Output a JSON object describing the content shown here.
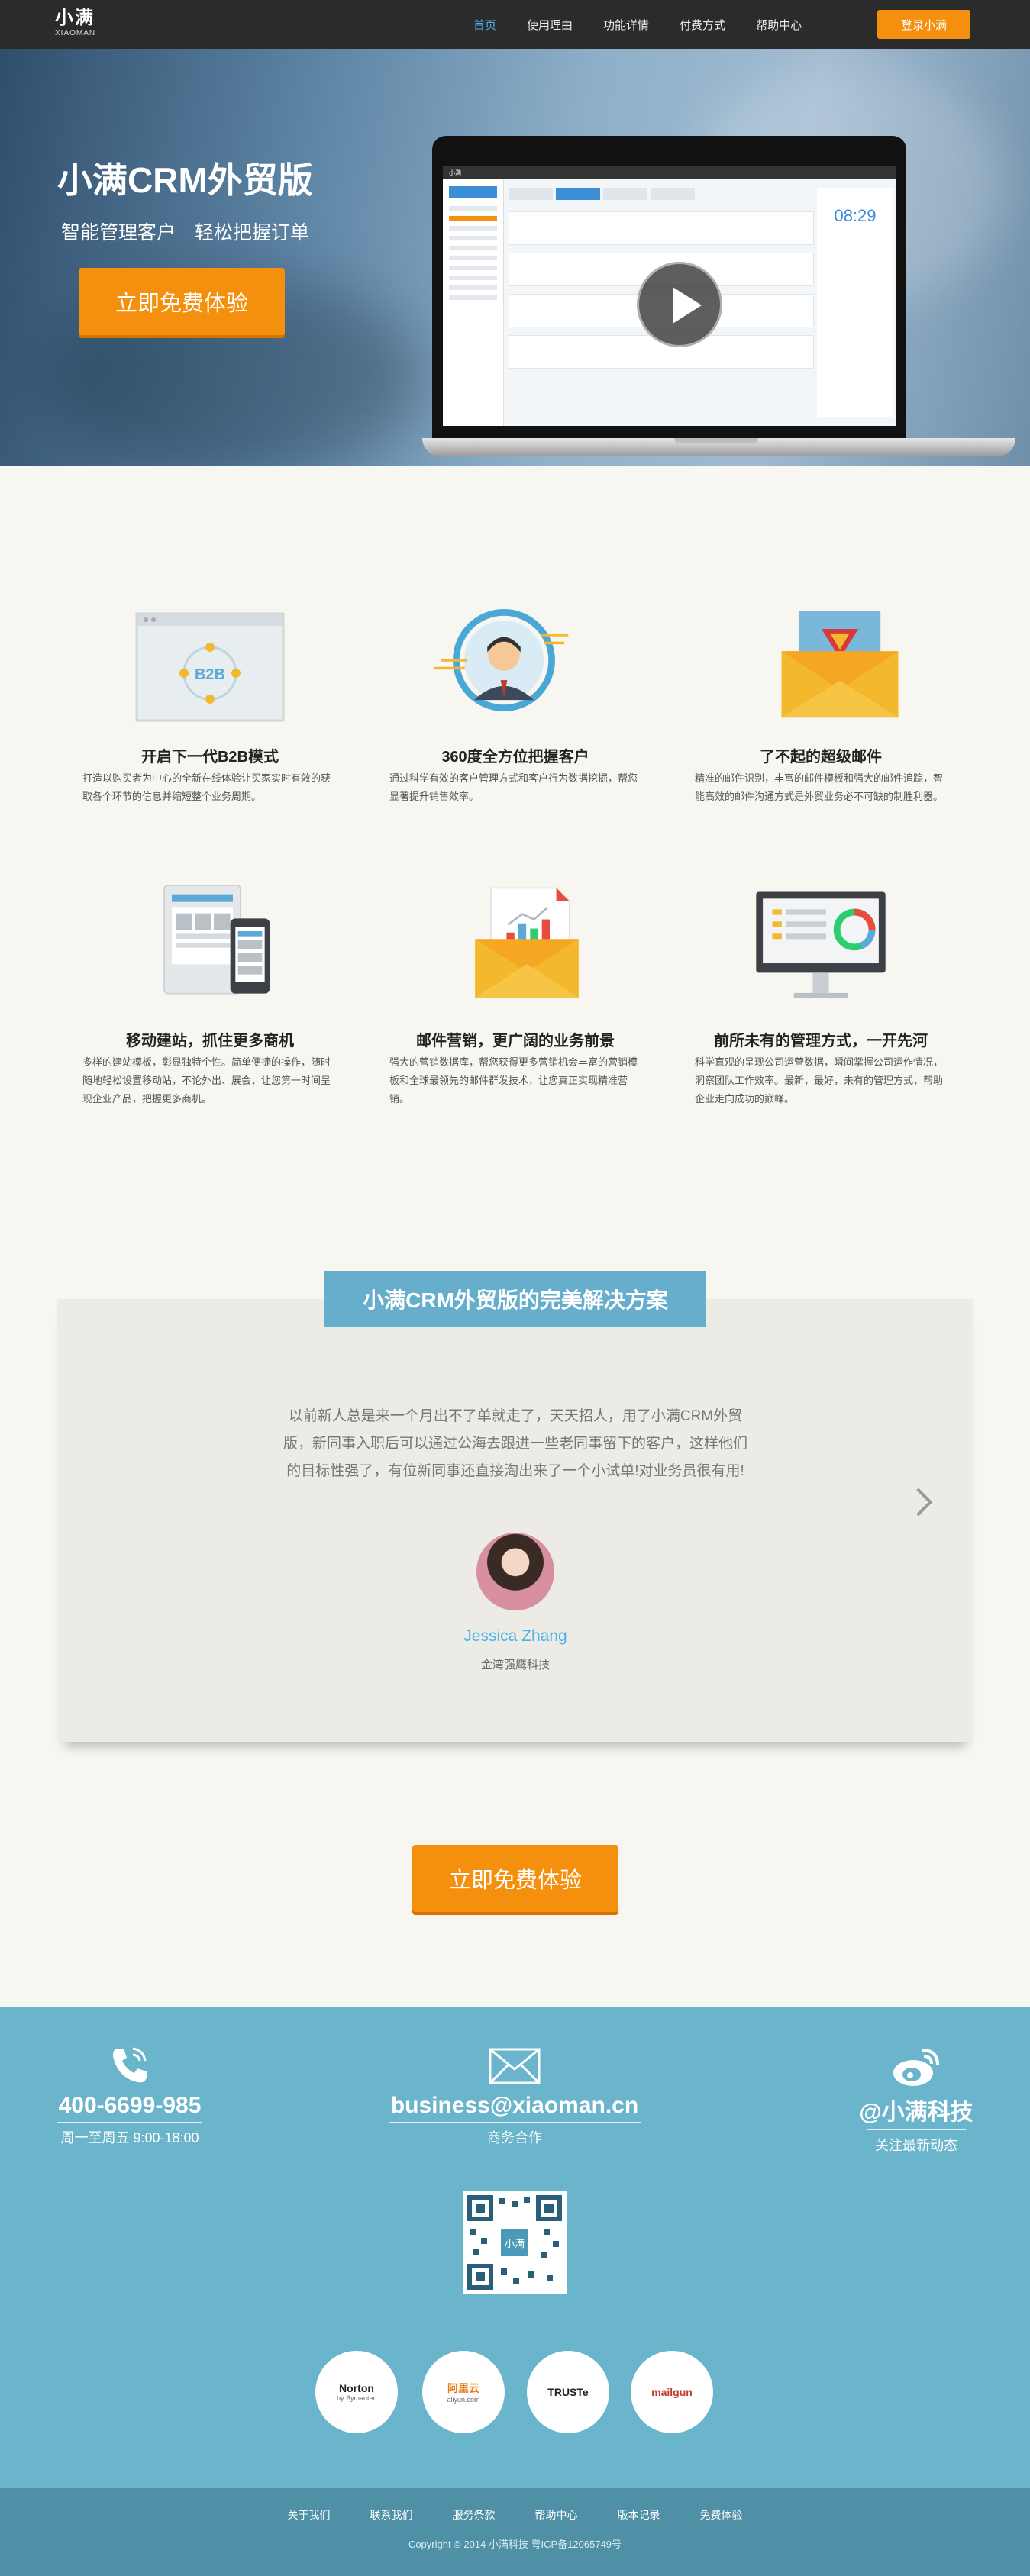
{
  "nav": {
    "logo_main": "小满",
    "logo_sub": "XIAOMAN",
    "items": [
      "首页",
      "使用理由",
      "功能详情",
      "付费方式",
      "帮助中心"
    ],
    "login": "登录小满"
  },
  "hero": {
    "title": "小满CRM外贸版",
    "subtitle": "智能管理客户 轻松把握订单",
    "cta": "立即免费体验",
    "screen_time": "08:29"
  },
  "features": [
    {
      "title": "开启下一代B2B模式",
      "desc": "打造以购买者为中心的全新在线体验让买家实时有效的获取各个环节的信息并缩短整个业务周期。",
      "icon": "b2b-icon"
    },
    {
      "title": "360度全方位把握客户",
      "desc": "通过科学有效的客户管理方式和客户行为数据挖掘，帮您显著提升销售效率。",
      "icon": "customer-360-icon"
    },
    {
      "title": "了不起的超级邮件",
      "desc": "精准的邮件识别，丰富的邮件模板和强大的邮件追踪，智能高效的邮件沟通方式是外贸业务必不可缺的制胜利器。",
      "icon": "super-mail-icon"
    },
    {
      "title": "移动建站，抓住更多商机",
      "desc": "多样的建站模板，彰显独特个性。简单便捷的操作，随时随地轻松设置移动站，不论外出、展会，让您第一时间呈现企业产品，把握更多商机。",
      "icon": "mobile-site-icon"
    },
    {
      "title": "邮件营销，更广阔的业务前景",
      "desc": "强大的营销数据库，帮您获得更多营销机会丰富的营销模板和全球最领先的邮件群发技术，让您真正实现精准营销。",
      "icon": "email-marketing-icon"
    },
    {
      "title": "前所未有的管理方式，一开先河",
      "desc": "科学直观的呈现公司运营数据，瞬间掌握公司运作情况，洞察团队工作效率。最新，最好，未有的管理方式，帮助企业走向成功的巅峰。",
      "icon": "management-dashboard-icon"
    }
  ],
  "testimonial": {
    "heading": "小满CRM外贸版的完美解决方案",
    "quote": "以前新人总是来一个月出不了单就走了，天天招人，用了小满CRM外贸版，新同事入职后可以通过公海去跟进一些老同事留下的客户，这样他们的目标性强了，有位新同事还直接淘出来了一个小试单!对业务员很有用!",
    "name": "Jessica Zhang",
    "company": "金湾强鹰科技"
  },
  "cta2": "立即免费体验",
  "footer": {
    "phone": "400-6699-985",
    "phone_sub": "周一至周五 9:00-18:00",
    "email": "business@xiaoman.cn",
    "email_sub": "商务合作",
    "weibo": "@小满科技",
    "weibo_sub": "关注最新动态",
    "qr_label": "小满",
    "badges": [
      {
        "name": "Norton",
        "sub": "by Symantec"
      },
      {
        "name": "阿里云",
        "sub": "aliyun.com"
      },
      {
        "name": "TRUSTe",
        "sub": ""
      },
      {
        "name": "mailgun",
        "sub": ""
      }
    ],
    "links": [
      "关于我们",
      "联系我们",
      "服务条款",
      "帮助中心",
      "版本记录",
      "免费体验"
    ],
    "copyright": "Copyright © 2014 小满科技 粤ICP备12065749号"
  },
  "colors": {
    "accent": "#f5900f",
    "nav_bg": "#2b2b2b",
    "link_blue": "#4ab3e8",
    "footer_bg": "#6ab4cc",
    "bottom_bar": "#4f90a6"
  }
}
